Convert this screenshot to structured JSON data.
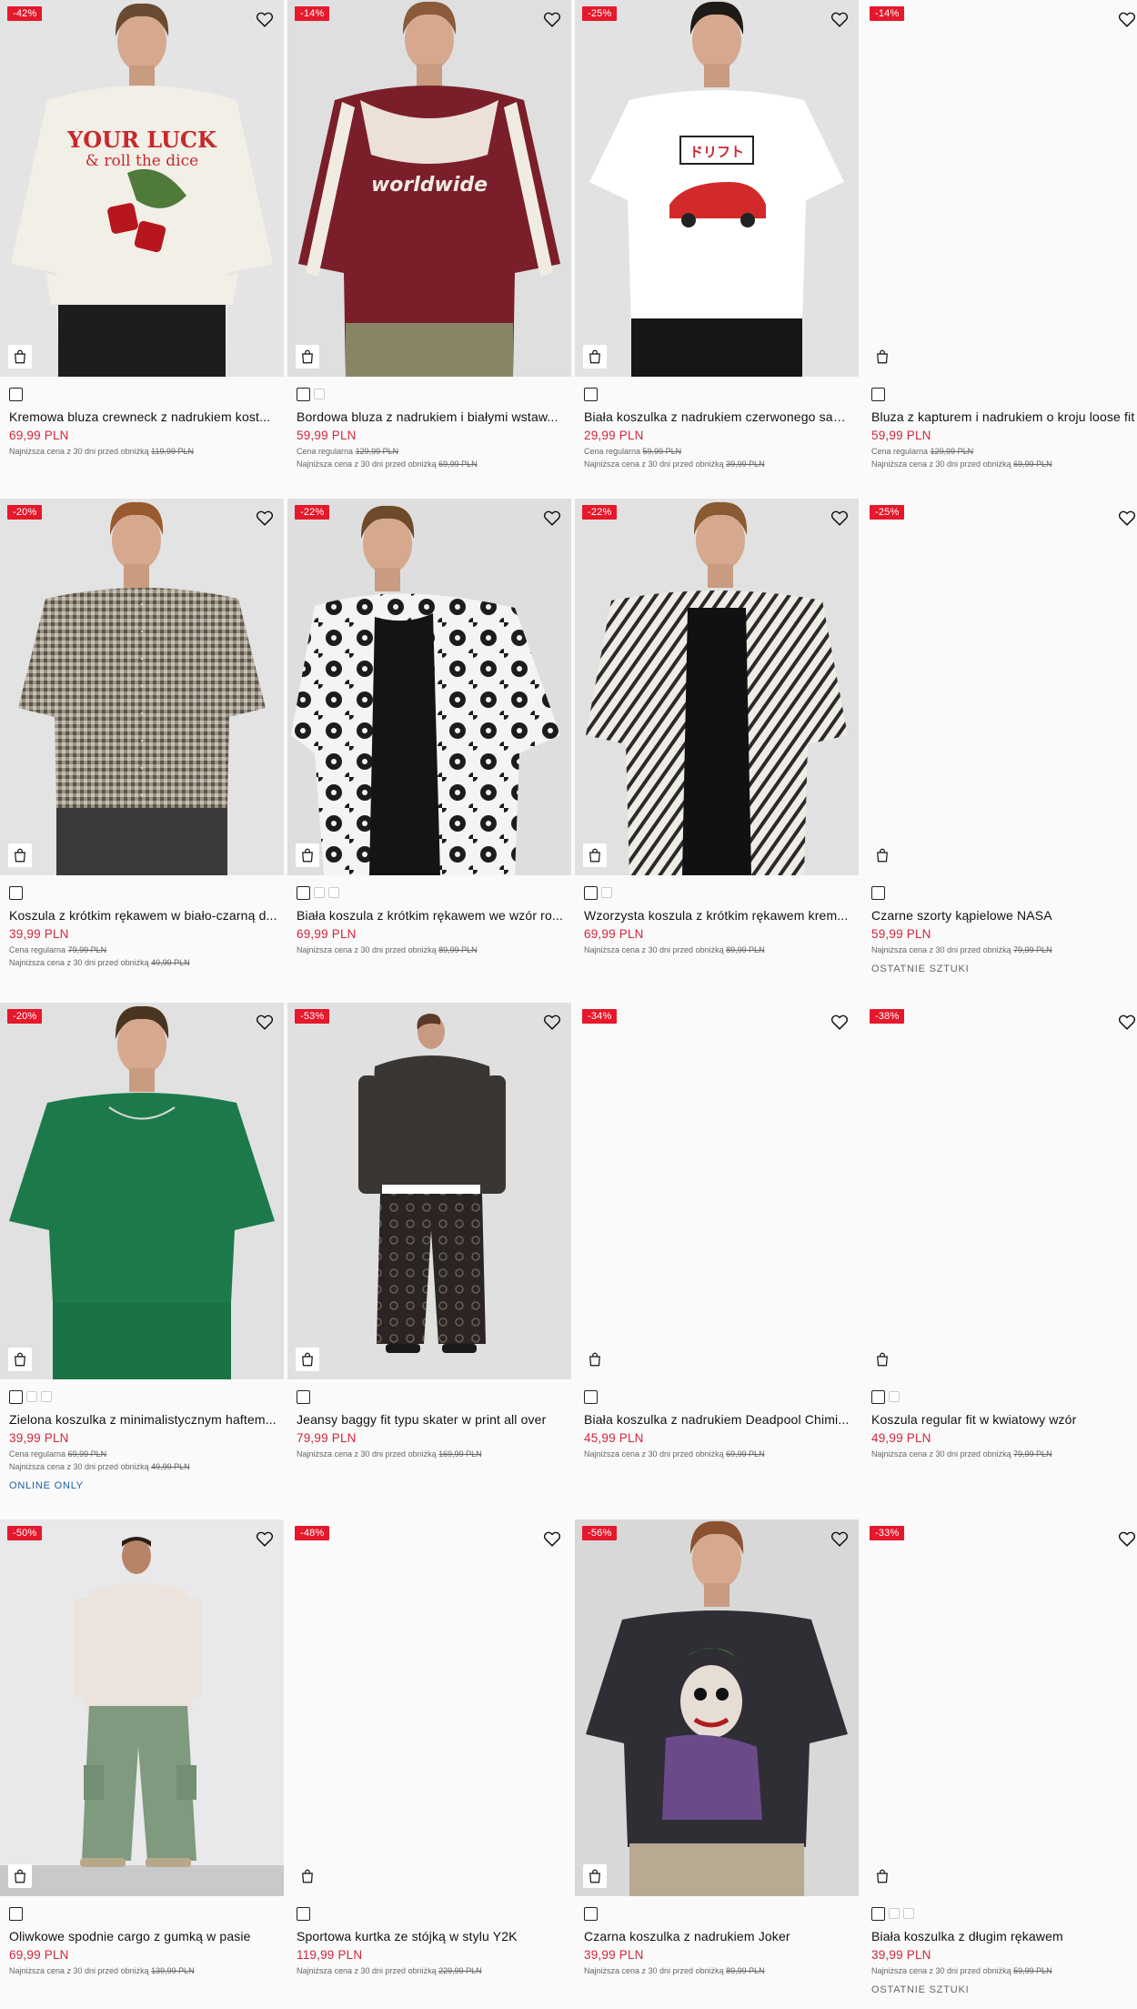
{
  "icons": {
    "wishlist": "heart-outline-icon",
    "add_to_bag": "shopping-bag-icon"
  },
  "colors": {
    "discount_badge": "#e5182c",
    "price": "#d0263a",
    "online_only": "#1b5fa8"
  },
  "products": [
    {
      "badge": "-42%",
      "name": "Kremowa bluza crewneck z nadrukiem kost...",
      "price": "69,99 PLN",
      "regular_label": "",
      "regular_price": "",
      "lowest_label": "Najniższa cena z 30 dni przed obniżką",
      "lowest_price": "119,99 PLN",
      "tag": "",
      "swatches": 1,
      "image": "sweat-cream"
    },
    {
      "badge": "-14%",
      "name": "Bordowa bluza z nadrukiem i białymi wstaw...",
      "price": "59,99 PLN",
      "regular_label": "Cena regularna",
      "regular_price": "129,99 PLN",
      "lowest_label": "Najniższa cena z 30 dni przed obniżką",
      "lowest_price": "69,99 PLN",
      "tag": "",
      "swatches": 2,
      "image": "sweat-burgundy"
    },
    {
      "badge": "-25%",
      "name": "Biała koszulka z nadrukiem czerwonego sam...",
      "price": "29,99 PLN",
      "regular_label": "Cena regularna",
      "regular_price": "59,99 PLN",
      "lowest_label": "Najniższa cena z 30 dni przed obniżką",
      "lowest_price": "39,99 PLN",
      "tag": "",
      "swatches": 1,
      "image": "tee-car"
    },
    {
      "badge": "-14%",
      "name": "Bluza z kapturem i nadrukiem o kroju loose fit",
      "price": "59,99 PLN",
      "regular_label": "Cena regularna",
      "regular_price": "129,99 PLN",
      "lowest_label": "Najniższa cena z 30 dni przed obniżką",
      "lowest_price": "69,99 PLN",
      "tag": "",
      "swatches": 1,
      "image": "blank"
    },
    {
      "badge": "-20%",
      "name": "Koszula z krótkim rękawem w biało-czarną d...",
      "price": "39,99 PLN",
      "regular_label": "Cena regularna",
      "regular_price": "79,99 PLN",
      "lowest_label": "Najniższa cena z 30 dni przed obniżką",
      "lowest_price": "49,99 PLN",
      "tag": "",
      "swatches": 1,
      "image": "shirt-check"
    },
    {
      "badge": "-22%",
      "name": "Biała koszula z krótkim rękawem we wzór ro...",
      "price": "69,99 PLN",
      "regular_label": "",
      "regular_price": "",
      "lowest_label": "Najniższa cena z 30 dni przed obniżką",
      "lowest_price": "89,99 PLN",
      "tag": "",
      "swatches": 3,
      "image": "shirt-floral"
    },
    {
      "badge": "-22%",
      "name": "Wzorzysta koszula z krótkim rękawem krem...",
      "price": "69,99 PLN",
      "regular_label": "",
      "regular_price": "",
      "lowest_label": "Najniższa cena z 30 dni przed obniżką",
      "lowest_price": "89,99 PLN",
      "tag": "",
      "swatches": 2,
      "image": "shirt-zebra"
    },
    {
      "badge": "-25%",
      "name": "Czarne szorty kąpielowe NASA",
      "price": "59,99 PLN",
      "regular_label": "",
      "regular_price": "",
      "lowest_label": "Najniższa cena z 30 dni przed obniżką",
      "lowest_price": "79,99 PLN",
      "tag": "OSTATNIE SZTUKI",
      "tag_type": "last",
      "swatches": 1,
      "image": "blank"
    },
    {
      "badge": "-20%",
      "name": "Zielona koszulka z minimalistycznym haftem...",
      "price": "39,99 PLN",
      "regular_label": "Cena regularna",
      "regular_price": "69,99 PLN",
      "lowest_label": "Najniższa cena z 30 dni przed obniżką",
      "lowest_price": "49,99 PLN",
      "tag": "ONLINE ONLY",
      "tag_type": "online",
      "swatches": 3,
      "image": "tee-green"
    },
    {
      "badge": "-53%",
      "name": "Jeansy baggy fit typu skater w print all over",
      "price": "79,99 PLN",
      "regular_label": "",
      "regular_price": "",
      "lowest_label": "Najniższa cena z 30 dni przed obniżką",
      "lowest_price": "169,99 PLN",
      "tag": "",
      "swatches": 1,
      "image": "jeans-print"
    },
    {
      "badge": "-34%",
      "name": "Biała koszulka z nadrukiem Deadpool Chimi...",
      "price": "45,99 PLN",
      "regular_label": "",
      "regular_price": "",
      "lowest_label": "Najniższa cena z 30 dni przed obniżką",
      "lowest_price": "69,99 PLN",
      "tag": "",
      "swatches": 1,
      "image": "blank"
    },
    {
      "badge": "-38%",
      "name": "Koszula regular fit w kwiatowy wzór",
      "price": "49,99 PLN",
      "regular_label": "",
      "regular_price": "",
      "lowest_label": "Najniższa cena z 30 dni przed obniżką",
      "lowest_price": "79,99 PLN",
      "tag": "",
      "swatches": 2,
      "image": "blank"
    },
    {
      "badge": "-50%",
      "name": "Oliwkowe spodnie cargo z gumką w pasie",
      "price": "69,99 PLN",
      "regular_label": "",
      "regular_price": "",
      "lowest_label": "Najniższa cena z 30 dni przed obniżką",
      "lowest_price": "139,99 PLN",
      "tag": "",
      "swatches": 1,
      "image": "cargo-olive"
    },
    {
      "badge": "-48%",
      "name": "Sportowa kurtka ze stójką w stylu Y2K",
      "price": "119,99 PLN",
      "regular_label": "",
      "regular_price": "",
      "lowest_label": "Najniższa cena z 30 dni przed obniżką",
      "lowest_price": "229,99 PLN",
      "tag": "",
      "swatches": 1,
      "image": "blank"
    },
    {
      "badge": "-56%",
      "name": "Czarna koszulka z nadrukiem Joker",
      "price": "39,99 PLN",
      "regular_label": "",
      "regular_price": "",
      "lowest_label": "Najniższa cena z 30 dni przed obniżką",
      "lowest_price": "89,99 PLN",
      "tag": "",
      "swatches": 1,
      "image": "tee-joker"
    },
    {
      "badge": "-33%",
      "name": "Biała koszulka z długim rękawem",
      "price": "39,99 PLN",
      "regular_label": "",
      "regular_price": "",
      "lowest_label": "Najniższa cena z 30 dni przed obniżką",
      "lowest_price": "59,99 PLN",
      "tag": "OSTATNIE SZTUKI",
      "tag_type": "last",
      "swatches": 3,
      "image": "blank"
    }
  ]
}
